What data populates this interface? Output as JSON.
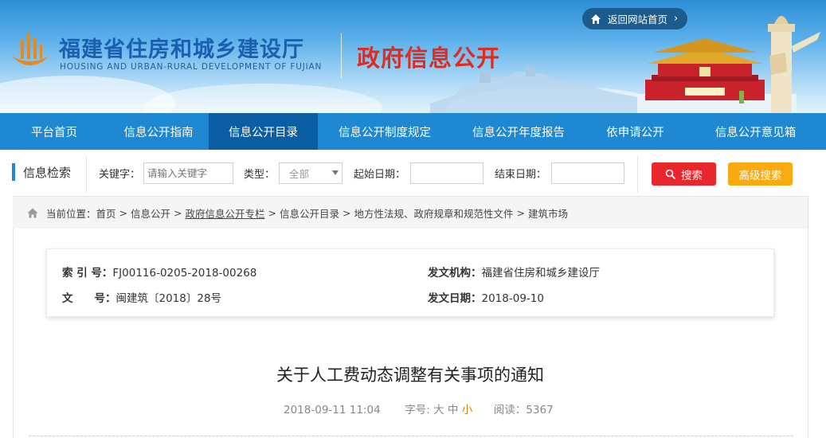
{
  "header": {
    "title_cn": "福建省住房和城乡建设厅",
    "title_en": "HOUSING AND URBAN-RURAL DEVELOPMENT OF FUJIAN",
    "section_title": "政府信息公开",
    "home_link": "返回网站首页",
    "colors": {
      "title": "#1a5fb0",
      "section": "#e02b1f",
      "home_link_bg": "#1d5b8c"
    }
  },
  "nav": {
    "items": [
      {
        "label": "平台首页"
      },
      {
        "label": "信息公开指南"
      },
      {
        "label": "信息公开目录",
        "active": true
      },
      {
        "label": "信息公开制度规定"
      },
      {
        "label": "信息公开年度报告"
      },
      {
        "label": "依申请公开"
      },
      {
        "label": "信息公开意见箱"
      }
    ],
    "colors": {
      "bg": "#1e88d3",
      "active_bg": "#0c5ea4"
    }
  },
  "search": {
    "heading": "信息检索",
    "keyword_label": "关键字：",
    "keyword_placeholder": "请输入关键字",
    "type_label": "类型：",
    "type_value": "全部",
    "start_label": "起始日期：",
    "end_label": "结束日期：",
    "search_button": "搜索",
    "advanced_button": "高级搜索",
    "colors": {
      "search_btn": "#e8262b",
      "advanced_btn": "#f8aa10"
    }
  },
  "breadcrumb": {
    "prefix": "当前位置：",
    "items": [
      "首页",
      "信息公开",
      "政府信息公开专栏",
      "信息公开目录",
      "地方性法规、政府规章和规范性文件",
      "建筑市场"
    ],
    "separator": ">"
  },
  "meta": {
    "index_label": "索 引 号：",
    "index_value": "FJ00116-0205-2018-00268",
    "doc_no_label": "文　　号：",
    "doc_no_value": "闽建筑〔2018〕28号",
    "issuer_label": "发文机构：",
    "issuer_value": "福建省住房和城乡建设厅",
    "date_label": "发文日期：",
    "date_value": "2018-09-10"
  },
  "article": {
    "title": "关于人工费动态调整有关事项的通知",
    "datetime": "2018-09-11 11:04",
    "font_label": "字号:",
    "font_large": "大",
    "font_medium": "中",
    "font_small": "小",
    "views_label": "阅读：",
    "views": "5367"
  }
}
